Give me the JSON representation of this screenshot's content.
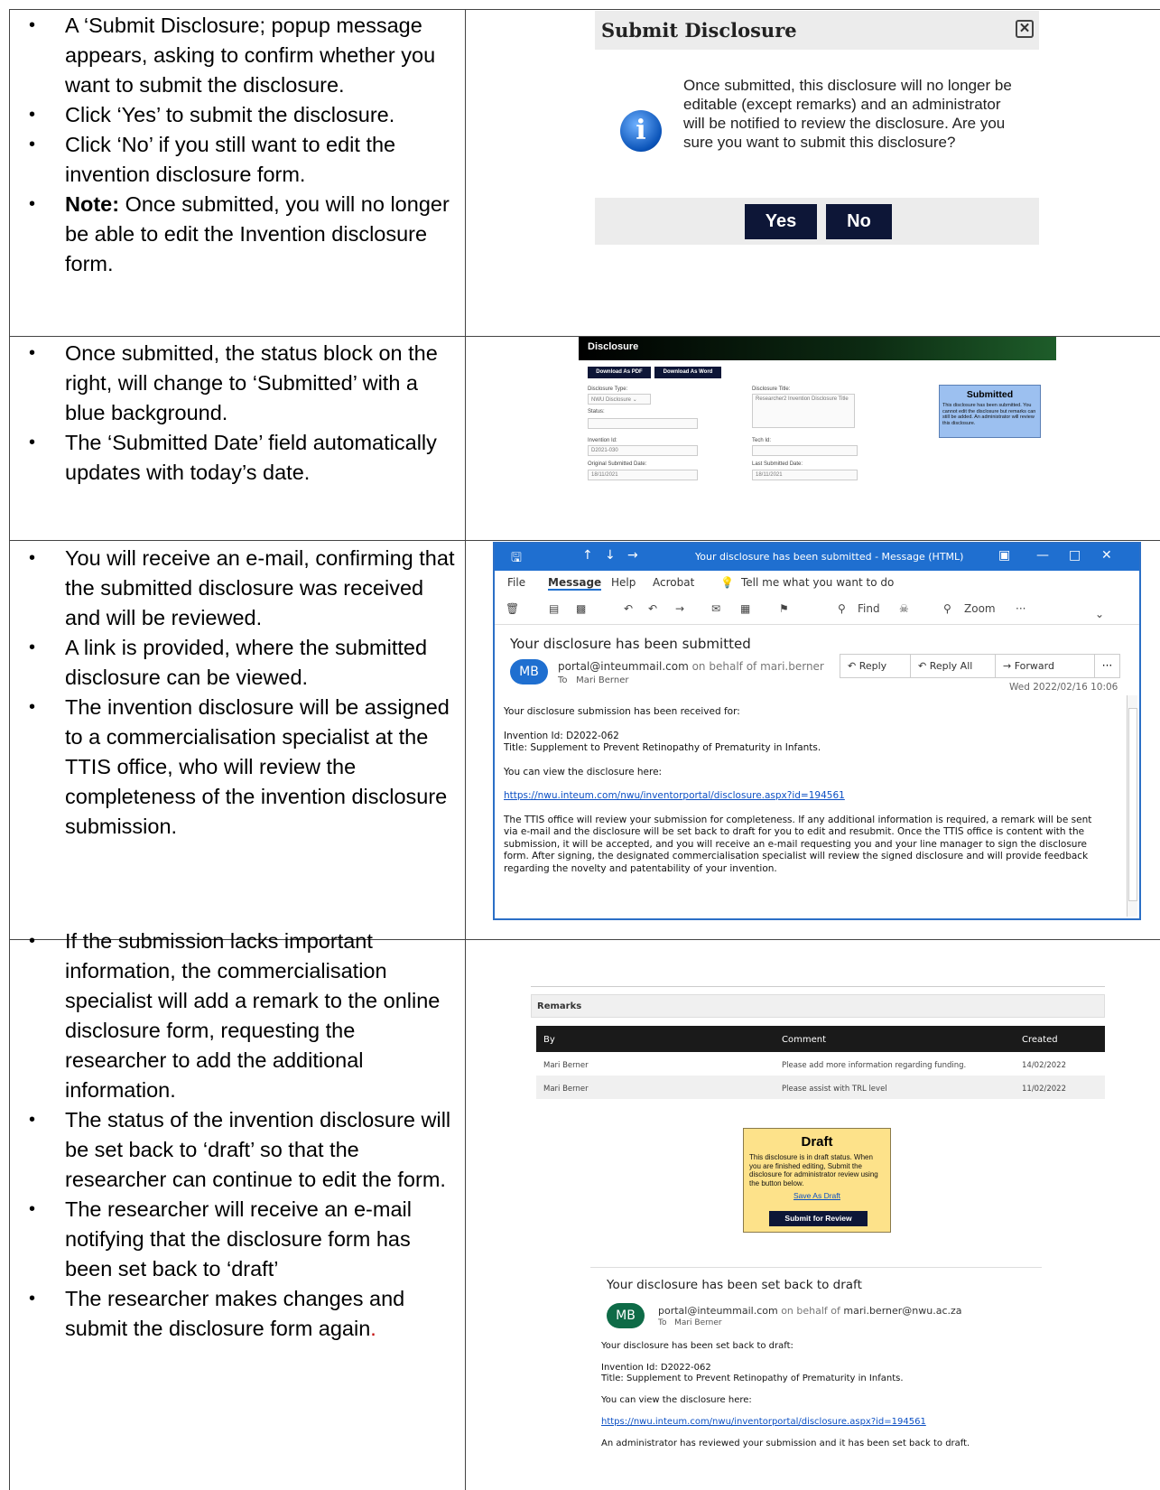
{
  "rows": [
    {
      "bullets": [
        {
          "text": "A ‘Submit Disclosure; popup message appears, asking to confirm whether you want to submit the disclosure."
        },
        {
          "text": "Click ‘Yes’ to submit the disclosure."
        },
        {
          "text": "Click ‘No’ if you still want to edit the invention disclosure form."
        },
        {
          "bold": "Note:",
          "text": " Once submitted, you will no longer be able to edit the Invention disclosure form."
        }
      ]
    },
    {
      "bullets": [
        {
          "text": "Once submitted, the status block on the right, will change to ‘Submitted’ with a blue background."
        },
        {
          "text": "The ‘Submitted Date’ field automatically updates with today’s date."
        }
      ]
    },
    {
      "bullets": [
        {
          "text": "You will receive an e-mail, confirming that the submitted disclosure was received and will be reviewed."
        },
        {
          "text": "A link is provided, where the submitted disclosure can be viewed."
        },
        {
          "text": "The invention disclosure will be assigned to a commercialisation specialist at the TTIS office, who will review the completeness of the invention disclosure submission."
        }
      ]
    },
    {
      "bullets": [
        {
          "text": "If the submission lacks important information, the commercialisation specialist will add a remark to the online disclosure form, requesting the researcher to add the additional information."
        },
        {
          "text": "The status of the invention disclosure will be set back to ‘draft’ so that the researcher can continue to edit the form."
        },
        {
          "text": "The researcher will receive an e-mail notifying that the disclosure form has been set back to ‘draft’"
        },
        {
          "text": "The researcher makes changes and submit the disclosure form again",
          "red_suffix": "."
        }
      ]
    }
  ],
  "dialog": {
    "title": "Submit Disclosure",
    "close_glyph": "✕",
    "info_glyph": "i",
    "message": "Once submitted, this disclosure will no longer be editable (except remarks) and an administrator will be notified to review the disclosure. Are you sure you want to submit this disclosure?",
    "yes_label": "Yes",
    "no_label": "No"
  },
  "disclosure": {
    "header": "Disclosure",
    "pdf_label": "Download As PDF",
    "word_label": "Download As Word",
    "type_label": "Disclosure Type:",
    "type_value": "NWU Disclosure",
    "status_label": "Status:",
    "invention_id_label": "Invention Id:",
    "invention_id_value": "D2021-030",
    "orig_date_label": "Original Submitted Date:",
    "orig_date_value": "18/11/2021",
    "title_label": "Disclosure Title:",
    "title_value": "Researcher2 Invention Disclosure Title",
    "tech_id_label": "Tech Id:",
    "last_date_label": "Last Submitted Date:",
    "last_date_value": "18/11/2021",
    "status_box_title": "Submitted",
    "status_box_text": "This disclosure has been submitted. You cannot edit the disclosure but remarks can still be added. An administrator will review this disclosure."
  },
  "outlook": {
    "window_title": "Your disclosure has been submitted  -  Message (HTML)",
    "menu": [
      "File",
      "Message",
      "Help",
      "Acrobat",
      "Tell me what you want to do"
    ],
    "find_label": "Find",
    "zoom_label": "Zoom",
    "subject": "Your disclosure has been submitted",
    "avatar": "MB",
    "from_email": "portal@inteummail.com",
    "from_behalf": "on behalf of",
    "from_name": "mari.berner",
    "to_label": "To",
    "to_name": "Mari Berner",
    "reply_label": "Reply",
    "reply_all_label": "Reply All",
    "forward_label": "Forward",
    "more_label": "···",
    "date": "Wed 2022/02/16 10:06",
    "body_intro": "Your disclosure submission has been received for:",
    "invention_line": "Invention Id: D2022-062",
    "title_line": "Title: Supplement to Prevent Retinopathy of Prematurity in Infants.",
    "view_line": "You can view the disclosure here:",
    "link": "https://nwu.inteum.com/nwu/inventorportal/disclosure.aspx?id=194561",
    "body_para": "The TTIS office will review your submission for completeness. If any additional information is required, a remark will be sent via e-mail and the disclosure will be set back to draft for you to edit and resubmit. Once the TTIS office is content with the submission, it will be accepted, and you will receive an e-mail requesting you and your line manager to sign the disclosure form. After signing, the designated commercialisation specialist will review the signed disclosure and will provide feedback regarding the novelty and patentability of your invention."
  },
  "remarks": {
    "header": "Remarks",
    "columns": [
      "By",
      "Comment",
      "Created"
    ],
    "rows": [
      {
        "by": "Mari Berner",
        "comment": "Please add more information regarding funding.",
        "created": "14/02/2022"
      },
      {
        "by": "Mari Berner",
        "comment": "Please assist with TRL level",
        "created": "11/02/2022"
      }
    ]
  },
  "draft_box": {
    "title": "Draft",
    "text": "This disclosure is in draft status. When you are finished editing, Submit the disclosure for administrator review using the button below.",
    "save_label": "Save As Draft",
    "submit_label": "Submit for Review"
  },
  "draft_email": {
    "subject": "Your disclosure has been set back to draft",
    "avatar": "MB",
    "from_email": "portal@inteummail.com",
    "from_behalf": "on behalf of",
    "from_name": "mari.berner@nwu.ac.za",
    "to_label": "To",
    "to_name": "Mari Berner",
    "intro": "Your disclosure has been set back to draft:",
    "invention_line": "Invention Id: D2022-062",
    "title_line": "Title: Supplement to Prevent Retinopathy of Prematurity in Infants.",
    "view_line": "You can view the disclosure here:",
    "link": "https://nwu.inteum.com/nwu/inventorportal/disclosure.aspx?id=194561",
    "closing": "An administrator has reviewed your submission and it has been set back to draft."
  }
}
